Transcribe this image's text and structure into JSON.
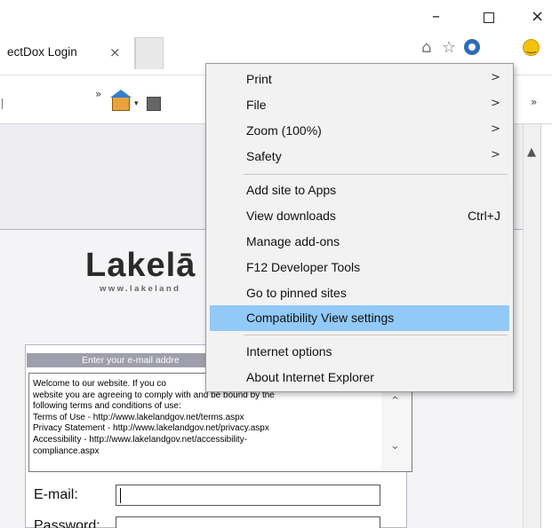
{
  "browser": {
    "tab_title": "ectDox Login",
    "tab_close": "×",
    "window_controls": {
      "minimize": "–",
      "maximize": "",
      "close": "×"
    },
    "toolbar_icons": [
      "home-icon",
      "star-icon",
      "gear-icon",
      "smiley-icon"
    ],
    "command_bar": {
      "chevron": "»",
      "caret": "▾"
    }
  },
  "tools_menu": {
    "items": [
      {
        "label": "Print",
        "arrow": ">"
      },
      {
        "label": "File",
        "arrow": ">"
      },
      {
        "label": "Zoom (100%)",
        "arrow": ">"
      },
      {
        "label": "Safety",
        "arrow": ">"
      },
      {
        "label": "Add site to Apps"
      },
      {
        "label": "View downloads",
        "shortcut": "Ctrl+J"
      },
      {
        "label": "Manage add-ons"
      },
      {
        "label": "F12 Developer Tools"
      },
      {
        "label": "Go to pinned sites"
      },
      {
        "label": "Compatibility View settings",
        "highlighted": true
      },
      {
        "label": "Internet options"
      },
      {
        "label": "About Internet Explorer"
      }
    ]
  },
  "page": {
    "logo_text": "Lakelā",
    "logo_url": "www.lakeland",
    "panel_header": "Enter your e-mail addre",
    "terms_lines": [
      "Welcome to our website. If you co",
      "website you are agreeing to comply with and be bound by the",
      "following terms and conditions of use:",
      "Terms of Use - http://www.lakelandgov.net/terms.aspx",
      "Privacy Statement - http://www.lakelandgov.net/privacy.aspx",
      "Accessibility - http://www.lakelandgov.net/accessibility-",
      "compliance.aspx"
    ],
    "email_label": "E-mail:",
    "email_value": "",
    "password_label": "Password:",
    "password_value": ""
  },
  "colors": {
    "menu_bg": "#f2f2f2",
    "menu_highlight": "#91c9f7",
    "page_bg": "#eeeef2",
    "panel_header": "#9e9eac"
  }
}
